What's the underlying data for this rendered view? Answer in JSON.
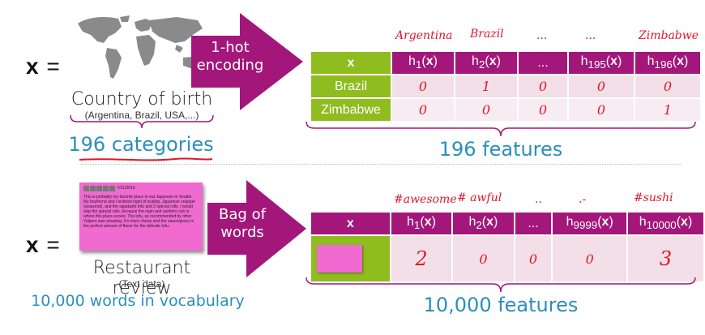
{
  "top": {
    "x_label": "x",
    "equals": "=",
    "caption": "Country of birth",
    "subcaption": "(Argentina, Brazil, USA,...)",
    "categories": "196 categories",
    "arrow_line1": "1-hot",
    "arrow_line2": "encoding",
    "features": "196 features",
    "handwritten_headers": [
      "Argentina",
      "Brazil",
      "...",
      "...",
      "Zimbabwe"
    ],
    "table": {
      "header": [
        "x",
        "h1(x)",
        "h2(x)",
        "...",
        "h195(x)",
        "h196(x)"
      ],
      "rows": [
        {
          "label": "Brazil",
          "values": [
            "0",
            "1",
            "0",
            "0",
            "0"
          ]
        },
        {
          "label": "Zimbabwe",
          "values": [
            "0",
            "0",
            "0",
            "0",
            "1"
          ]
        }
      ]
    }
  },
  "bottom": {
    "x_label": "x",
    "equals": "=",
    "caption": "Restaurant review",
    "subcaption": "(Text data)",
    "vocab": "10,000 words in vocabulary",
    "arrow_line1": "Bag of",
    "arrow_line2": "words",
    "features": "10,000 features",
    "handwritten_headers": [
      "#awesome",
      "# awful",
      "..",
      ".-",
      "#sushi"
    ],
    "review": {
      "date": "7/21/2016",
      "text": "This is probably my favorite place to eat Japanese in Seattle. My boyfriend and I ordered nigiri of scallop, Japanese snapper (seasonal), and the sigadashi tofu and 2 special rolls. I would skip the special rolls, because the nigiri and sashimi cuts is where this place excels. The tofu, as recommended by other Yelpers was amazing. It's more chewy and the sauce/gravy is the perfect amount of flavor for the delicate tofu."
    },
    "table": {
      "header": [
        "x",
        "h1(x)",
        "h2(x)",
        "...",
        "h9999(x)",
        "h10000(x)"
      ],
      "values": [
        "2",
        "0",
        "0",
        "0",
        "3"
      ]
    }
  },
  "colors": {
    "magenta": "#a3177a",
    "green": "#8fbc1e",
    "teal": "#2a8fbd",
    "red_ink": "#e0162b"
  }
}
